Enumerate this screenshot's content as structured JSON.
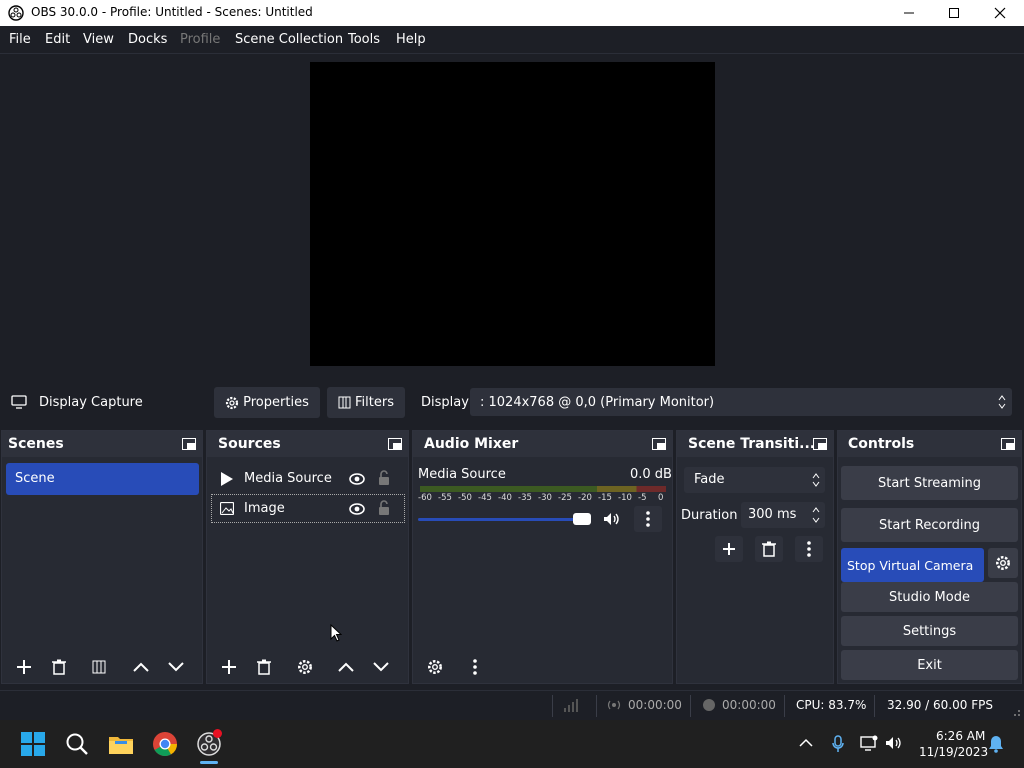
{
  "window": {
    "title": "OBS 30.0.0 - Profile: Untitled - Scenes: Untitled"
  },
  "menu": [
    "File",
    "Edit",
    "View",
    "Docks",
    "Profile",
    "Scene Collection",
    "Tools",
    "Help"
  ],
  "context_bar": {
    "source_label": "Display Capture",
    "properties_label": "Properties",
    "filters_label": "Filters",
    "display_label": "Display",
    "display_value": ": 1024x768 @ 0,0 (Primary Monitor)"
  },
  "scenes": {
    "title": "Scenes",
    "items": [
      "Scene"
    ]
  },
  "sources": {
    "title": "Sources",
    "items": [
      "Media Source",
      "Image"
    ]
  },
  "audio": {
    "title": "Audio Mixer",
    "channel": "Media Source",
    "level": "0.0 dB",
    "scale": [
      "-60",
      "-55",
      "-50",
      "-45",
      "-40",
      "-35",
      "-30",
      "-25",
      "-20",
      "-15",
      "-10",
      "-5",
      "0"
    ],
    "volume": 1.0
  },
  "transitions": {
    "title": "Scene Transiti...",
    "value": "Fade",
    "duration_label": "Duration",
    "duration_value": "300 ms"
  },
  "controls": {
    "title": "Controls",
    "start_streaming": "Start Streaming",
    "start_recording": "Start Recording",
    "virtual_camera": "Stop Virtual Camera",
    "studio_mode": "Studio Mode",
    "settings": "Settings",
    "exit": "Exit"
  },
  "status": {
    "stream_time": "00:00:00",
    "record_time": "00:00:00",
    "cpu": "CPU: 83.7%",
    "fps": "32.90 / 60.00 FPS"
  },
  "tray": {
    "time": "6:26 AM",
    "date": "11/19/2023"
  },
  "colors": {
    "accent": "#284cb8",
    "background": "#1d1f26",
    "dock": "#272a33"
  }
}
